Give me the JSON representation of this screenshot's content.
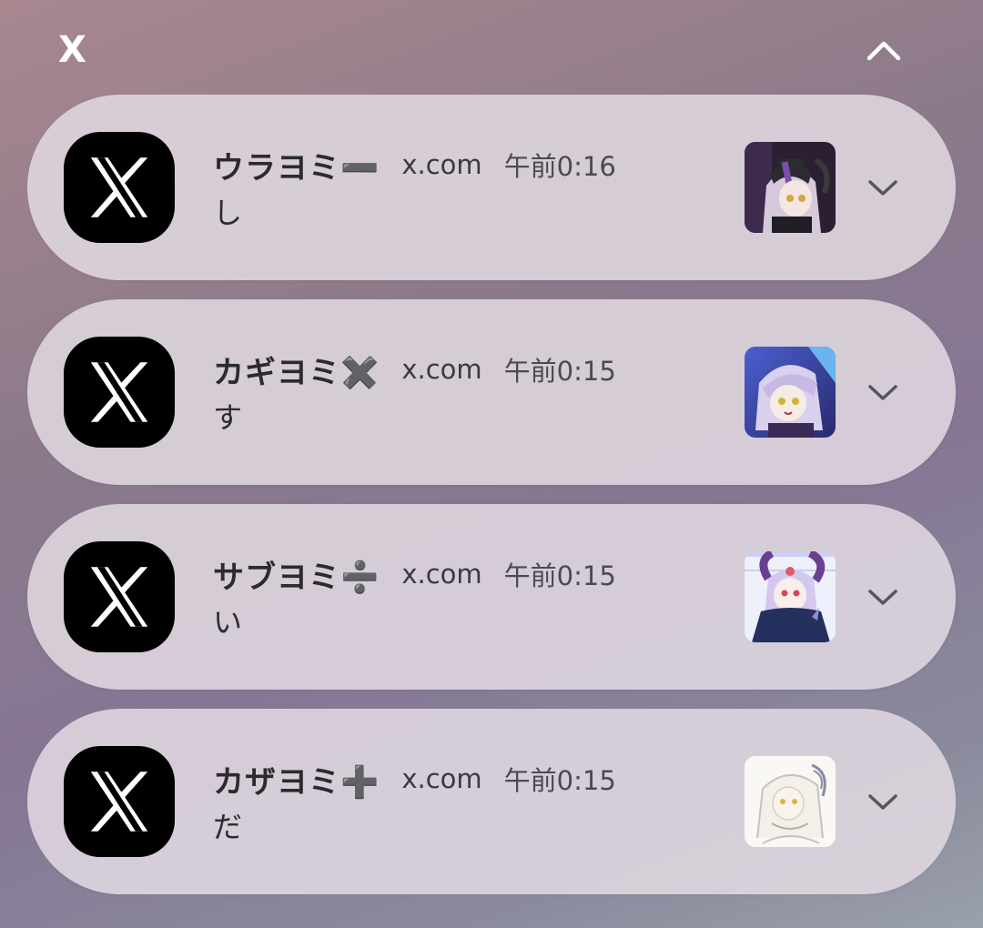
{
  "group": {
    "app_name": "X",
    "collapse_icon": "chevron-up-icon"
  },
  "notifications": [
    {
      "sender": "ウラヨミ➖",
      "source": "x.com",
      "time": "午前0:16",
      "message": "し",
      "app_icon": "x-logo-icon",
      "avatar": "avatar-image",
      "expand_icon": "chevron-down-icon"
    },
    {
      "sender": "カギヨミ✖️",
      "source": "x.com",
      "time": "午前0:15",
      "message": "す",
      "app_icon": "x-logo-icon",
      "avatar": "avatar-image",
      "expand_icon": "chevron-down-icon"
    },
    {
      "sender": "サブヨミ➗",
      "source": "x.com",
      "time": "午前0:15",
      "message": "い",
      "app_icon": "x-logo-icon",
      "avatar": "avatar-image",
      "expand_icon": "chevron-down-icon"
    },
    {
      "sender": "カザヨミ➕",
      "source": "x.com",
      "time": "午前0:15",
      "message": "だ",
      "app_icon": "x-logo-icon",
      "avatar": "avatar-image",
      "expand_icon": "chevron-down-icon"
    }
  ],
  "colors": {
    "card_background": "#e2dae2",
    "app_icon_background": "#000000",
    "text_primary": "#2b2b2f",
    "text_secondary": "#4a4a52"
  }
}
